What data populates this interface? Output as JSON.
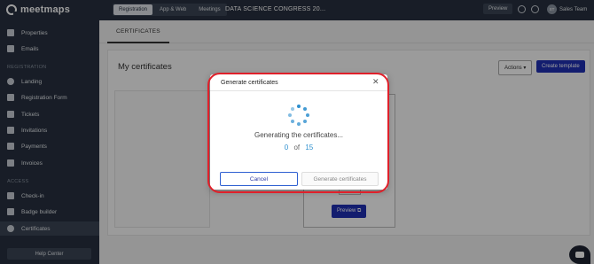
{
  "brand": {
    "name": "meetmaps"
  },
  "sidebar": {
    "items": [
      {
        "label": "Properties",
        "icon": "list-icon"
      },
      {
        "label": "Emails",
        "icon": "envelope-icon"
      }
    ],
    "section_registration": "REGISTRATION",
    "registration_items": [
      {
        "label": "Landing",
        "icon": "globe-icon"
      },
      {
        "label": "Registration Form",
        "icon": "form-icon"
      },
      {
        "label": "Tickets",
        "icon": "ticket-icon"
      },
      {
        "label": "Invitations",
        "icon": "invitation-icon"
      },
      {
        "label": "Payments",
        "icon": "card-icon"
      },
      {
        "label": "Invoices",
        "icon": "invoice-icon"
      }
    ],
    "section_access": "ACCESS",
    "access_items": [
      {
        "label": "Check-in",
        "icon": "checkin-icon"
      },
      {
        "label": "Badge builder",
        "icon": "grid-icon"
      },
      {
        "label": "Certificates",
        "icon": "certificate-icon",
        "active": true
      }
    ],
    "help_label": "Help Center"
  },
  "topbar": {
    "tabs": [
      "Registration",
      "App & Web",
      "Meetings"
    ],
    "event_title": "DATA SCIENCE CONGRESS 20...",
    "preview_label": "Preview",
    "user_initials": "ST",
    "user_name": "Sales Team"
  },
  "main": {
    "subtab": "CERTIFICATES",
    "title": "My certificates",
    "actions_label": "Actions ▾",
    "create_label": "Create template",
    "card_preview_label": "Preview ⧉"
  },
  "modal": {
    "title": "Generate certificates",
    "status_text": "Generating the certificates...",
    "progress_current": "0",
    "progress_of": "of",
    "progress_total": "15",
    "cancel_label": "Cancel",
    "generate_label": "Generate certificates",
    "highlight_color": "#e0202a",
    "accent_color": "#2e8fce"
  }
}
